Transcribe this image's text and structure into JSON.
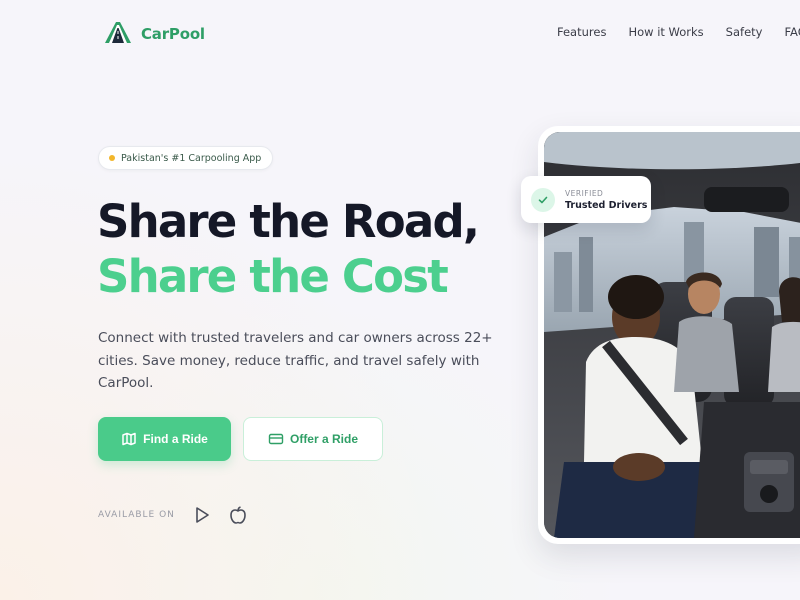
{
  "brand": {
    "name": "CarPool",
    "accent": "#4acb8a",
    "brand_text": "#2e9e66"
  },
  "nav": {
    "items": [
      {
        "label": "Features"
      },
      {
        "label": "How it Works"
      },
      {
        "label": "Safety"
      },
      {
        "label": "FAQ"
      }
    ]
  },
  "hero": {
    "badge": "Pakistan's #1 Carpooling App",
    "headline_line1": "Share the Road,",
    "headline_line2": "Share the Cost",
    "description": "Connect with trusted travelers and car owners across 22+ cities. Save money, reduce traffic, and travel safely with CarPool.",
    "primary_button": {
      "label": "Find a Ride",
      "icon": "map-icon"
    },
    "secondary_button": {
      "label": "Offer a Ride",
      "icon": "card-icon"
    },
    "available_on": "AVAILABLE ON",
    "stores": [
      "play-store-icon",
      "apple-icon"
    ]
  },
  "verified_card": {
    "small": "VERIFIED",
    "big": "Trusted Drivers",
    "icon": "check-icon"
  }
}
